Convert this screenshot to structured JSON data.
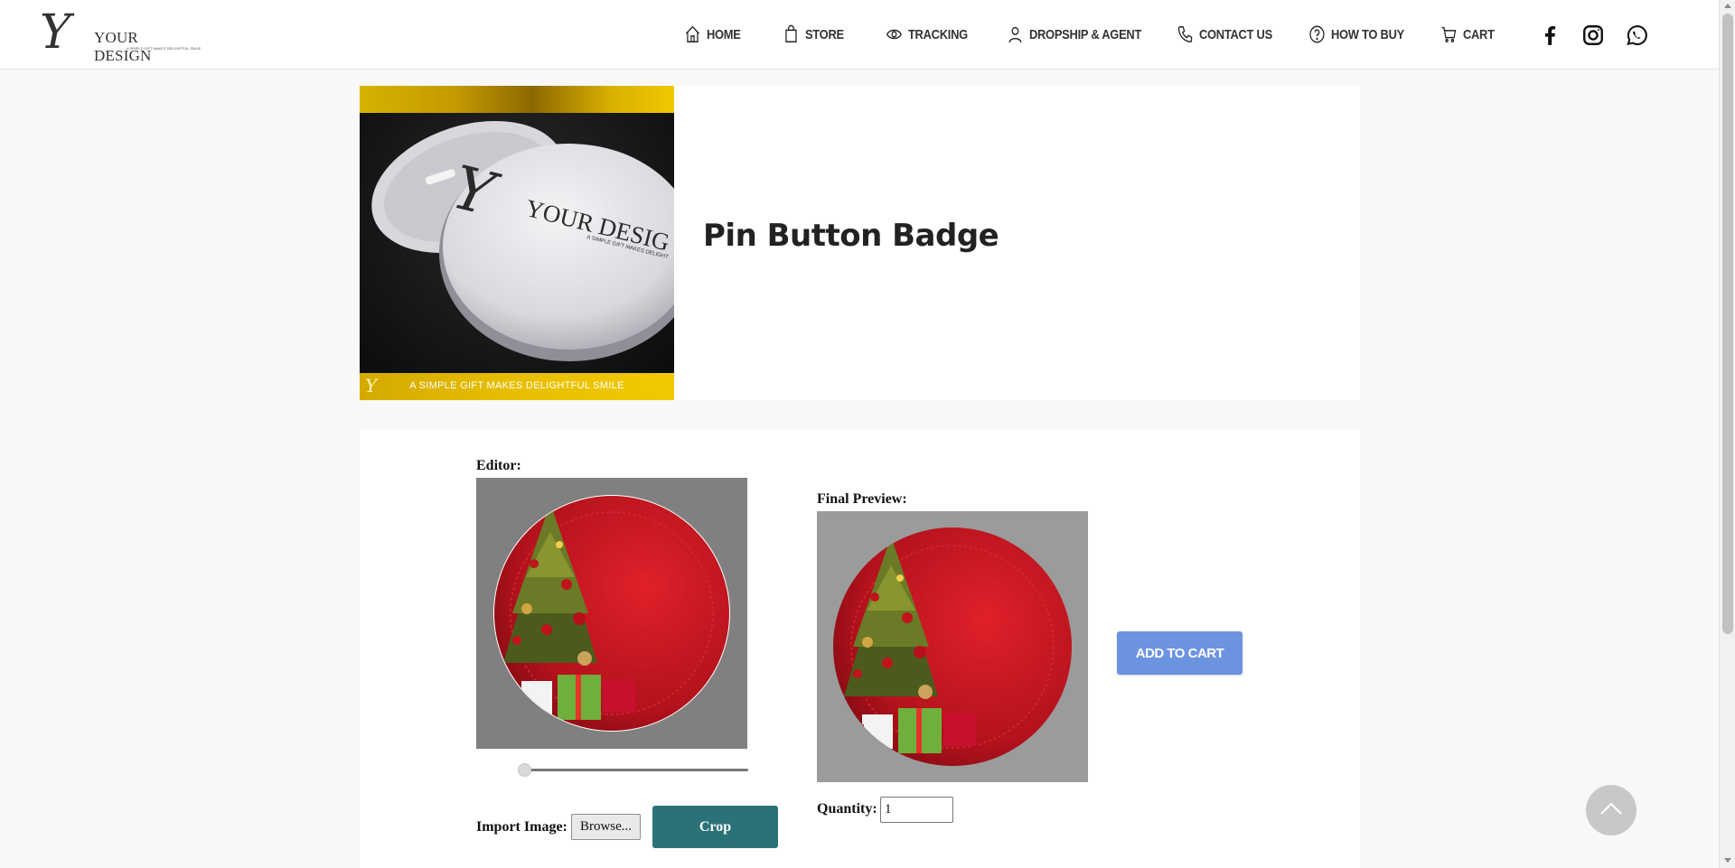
{
  "header": {
    "logo": {
      "mark": "Y",
      "name": "YOUR DESIGN",
      "tagline": "A SIMPLE GIFT MAKES DELIGHTFUL SMILE"
    },
    "nav": [
      {
        "label": "HOME",
        "icon": "home-icon"
      },
      {
        "label": "STORE",
        "icon": "shopping-bag-icon"
      },
      {
        "label": "TRACKING",
        "icon": "eye-icon"
      },
      {
        "label": "DROPSHIP & AGENT",
        "icon": "user-icon"
      },
      {
        "label": "CONTACT US",
        "icon": "phone-icon"
      },
      {
        "label": "HOW TO BUY",
        "icon": "question-icon"
      },
      {
        "label": "CART",
        "icon": "cart-icon"
      }
    ],
    "social": [
      "facebook-icon",
      "instagram-icon",
      "whatsapp-icon"
    ]
  },
  "product": {
    "title": "Pin Button Badge",
    "image": {
      "badge_text": "YOUR DESIG",
      "badge_tagline": "A SIMPLE GIFT MAKES DELIGHT",
      "banner": "A SIMPLE GIFT MAKES DELIGHTFUL SMILE",
      "mini_logo": "Y"
    }
  },
  "editor": {
    "editor_label": "Editor:",
    "preview_label": "Final Preview:",
    "zoom_level": 0,
    "import_label": "Import Image:",
    "browse_label": "Browse...",
    "crop_label": "Crop",
    "quantity_label": "Quantity:",
    "quantity_value": "1",
    "add_to_cart_label": "ADD TO CART"
  },
  "colors": {
    "gold": "#d4aa00",
    "crop_button": "#2b7278",
    "add_to_cart_button": "#6b93e0",
    "badge_red": "#b3121c"
  }
}
